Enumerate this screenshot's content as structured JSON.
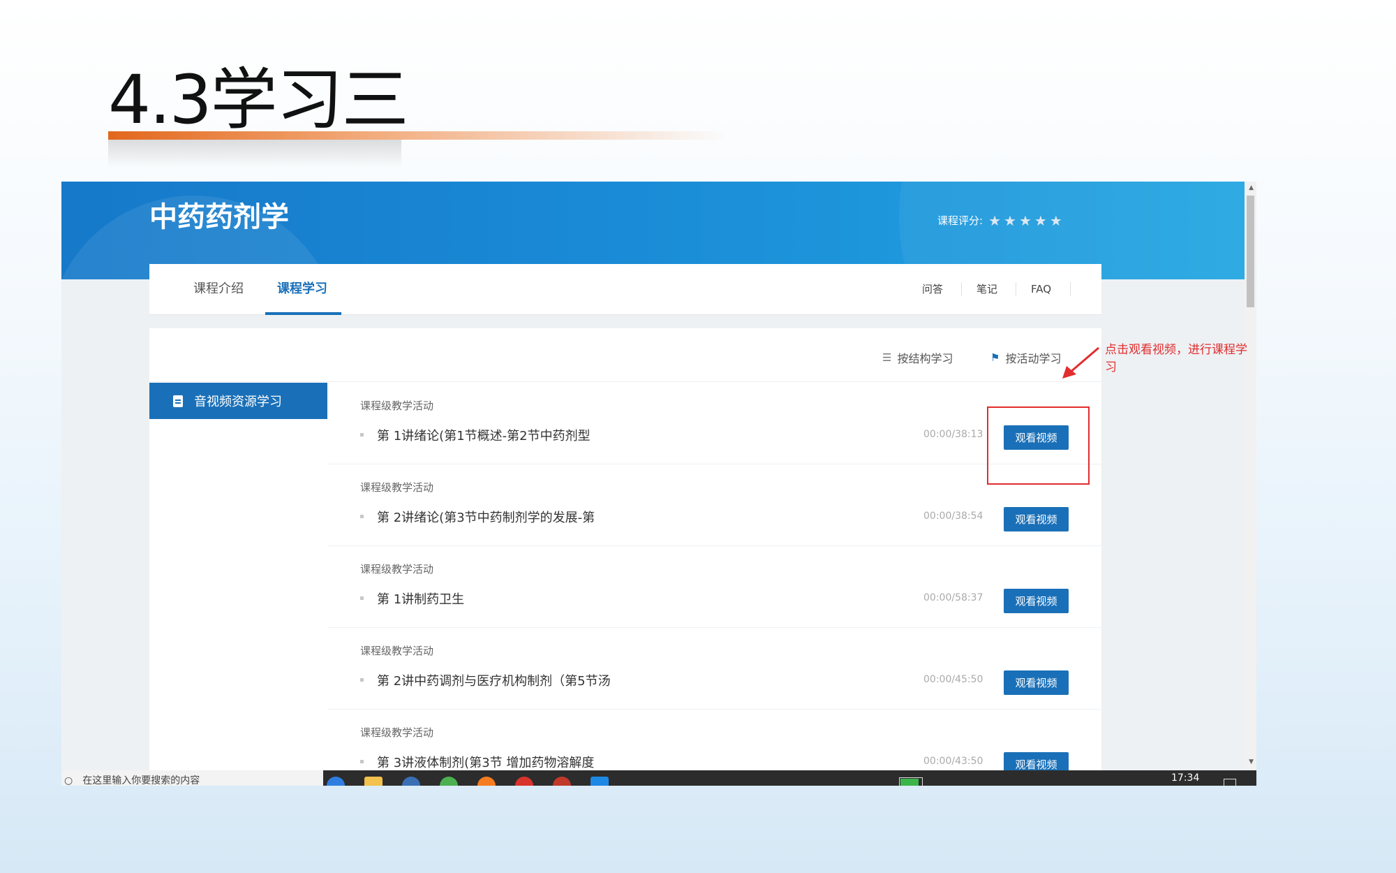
{
  "slide": {
    "title": "4.3学习三"
  },
  "course": {
    "title": "中药药剂学",
    "rating_label": "课程评分:",
    "rating_stars": 5
  },
  "tabs": [
    {
      "label": "课程介绍",
      "active": false
    },
    {
      "label": "课程学习",
      "active": true
    }
  ],
  "header_links": [
    "问答",
    "笔记",
    "FAQ"
  ],
  "study_modes": {
    "structure": "按结构学习",
    "activity": "按活动学习"
  },
  "sidebar": {
    "item": "音视频资源学习"
  },
  "activities": [
    {
      "category": "课程级教学活动",
      "title": "第 1讲绪论(第1节概述-第2节中药剂型",
      "time": "00:00/38:13",
      "button": "观看视频"
    },
    {
      "category": "课程级教学活动",
      "title": "第 2讲绪论(第3节中药制剂学的发展-第",
      "time": "00:00/38:54",
      "button": "观看视频"
    },
    {
      "category": "课程级教学活动",
      "title": "第 1讲制药卫生",
      "time": "00:00/58:37",
      "button": "观看视频"
    },
    {
      "category": "课程级教学活动",
      "title": "第 2讲中药调剂与医疗机构制剂（第5节汤",
      "time": "00:00/45:50",
      "button": "观看视频"
    },
    {
      "category": "课程级教学活动",
      "title": "第 3讲液体制剂(第3节 增加药物溶解度",
      "time": "00:00/43:50",
      "button": "观看视频"
    }
  ],
  "annotation": {
    "text": "点击观看视频，进行课程学习",
    "color": "#e12d2d"
  },
  "taskbar": {
    "search_placeholder": "在这里输入你要搜索的内容",
    "time": "17:34",
    "apps": [
      "browser-icon",
      "folder-icon",
      "mail-icon",
      "chrome-icon",
      "firefox-icon",
      "media-icon",
      "app-icon",
      "app2-icon"
    ]
  },
  "colors": {
    "brand": "#1a70b8",
    "accent": "#e2671c"
  }
}
